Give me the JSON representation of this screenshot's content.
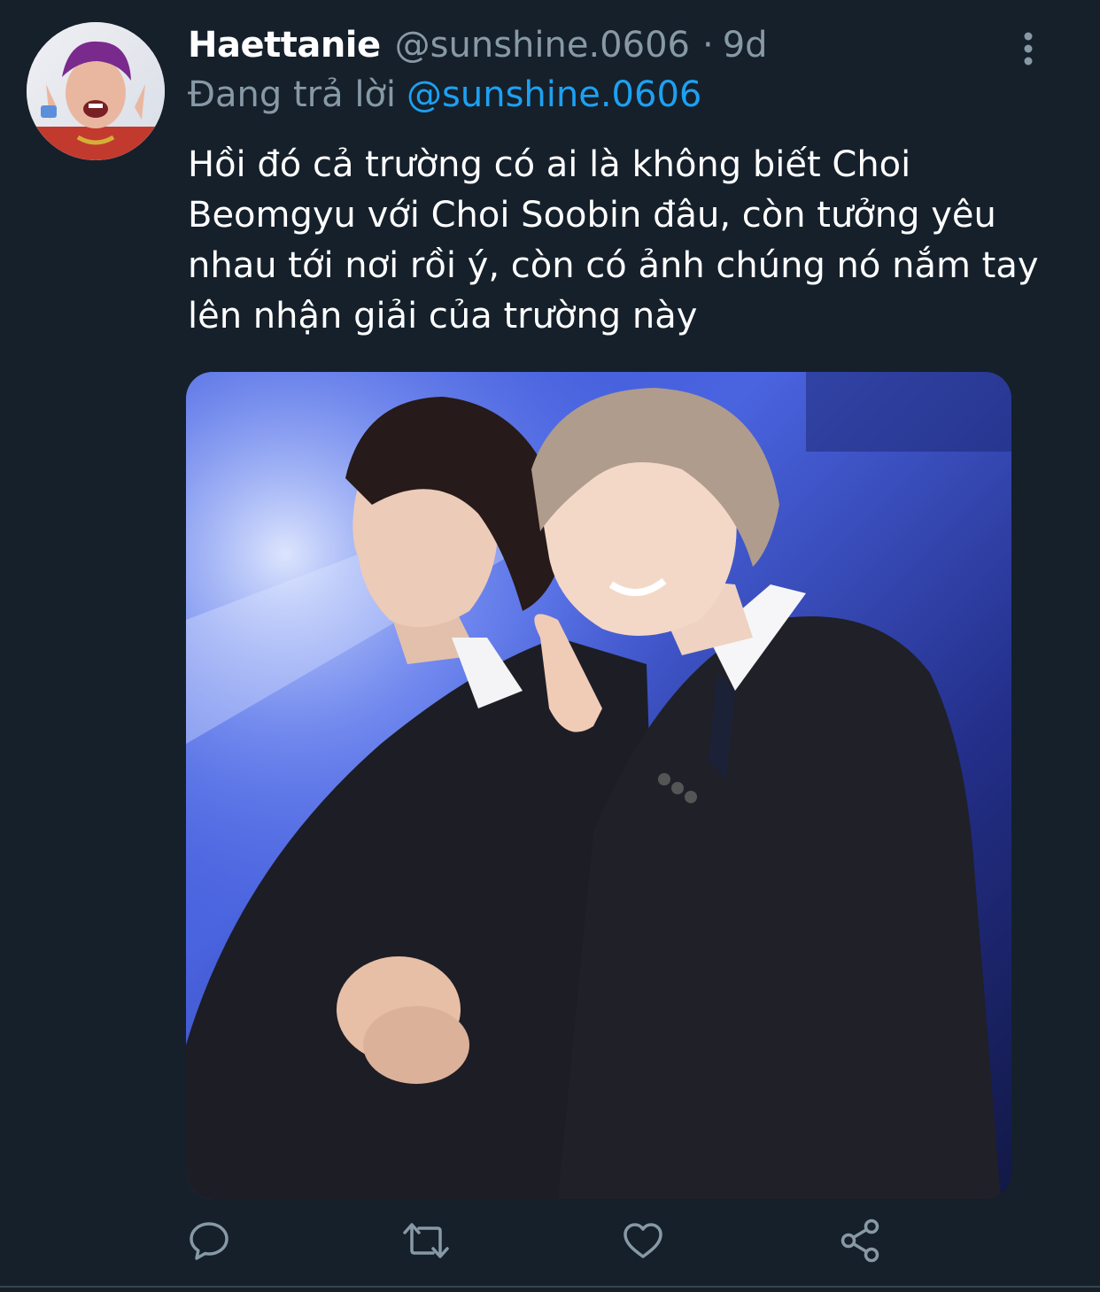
{
  "tweet": {
    "display_name": "Haettanie",
    "handle": "@sunshine.0606",
    "separator": "·",
    "time": "9d",
    "replying_prefix": "Đang trả lời",
    "replying_handle": "@sunshine.0606",
    "text": "Hồi đó cả trường có ai là không biết Choi Beomgyu với Choi Soobin đâu, còn tưởng yêu nhau tới nơi rồi ý, còn có ảnh chúng nó nắm tay lên nhận giải của trường này"
  },
  "actions": [
    {
      "icon": "reply-icon"
    },
    {
      "icon": "retweet-icon"
    },
    {
      "icon": "like-icon"
    },
    {
      "icon": "share-icon"
    }
  ],
  "colors": {
    "background": "#15202b",
    "primary_text": "#ffffff",
    "secondary_text": "#8899a6",
    "link": "#1da1f2"
  }
}
